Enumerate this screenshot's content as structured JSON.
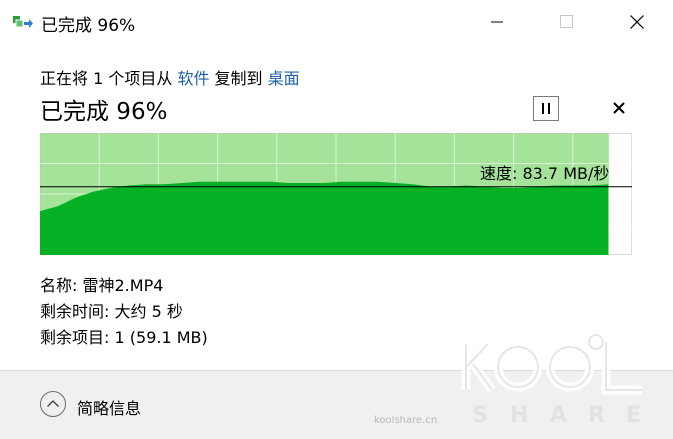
{
  "window": {
    "title": "已完成 96%",
    "icons": {
      "app": "copy-files-icon",
      "minimize": "minimize-icon",
      "maximize": "maximize-icon",
      "close": "close-icon"
    }
  },
  "copy_info": {
    "prefix": "正在将 1 个项目从 ",
    "source": "软件",
    "middle": " 复制到 ",
    "destination": "桌面"
  },
  "status": {
    "text": "已完成 96%",
    "percent": 96
  },
  "controls": {
    "pause_icon": "pause-icon",
    "stop_icon": "stop-icon"
  },
  "graph": {
    "speed_label": "速度: 83.7 MB/秒",
    "progress": 0.96,
    "fill_color": "#06b025",
    "background_color": "#a6e39a",
    "speed_line_level": 0.56,
    "speed_profile": [
      0.36,
      0.4,
      0.47,
      0.52,
      0.55,
      0.57,
      0.58,
      0.58,
      0.59,
      0.6,
      0.6,
      0.6,
      0.6,
      0.6,
      0.59,
      0.59,
      0.59,
      0.6,
      0.6,
      0.6,
      0.59,
      0.58,
      0.56,
      0.56,
      0.57,
      0.56,
      0.55,
      0.55,
      0.56,
      0.57,
      0.57,
      0.57,
      0.58
    ]
  },
  "details": {
    "name_label": "名称:",
    "name_value": "雷神2.MP4",
    "time_label": "剩余时间:",
    "time_value": "大约 5 秒",
    "items_label": "剩余项目:",
    "items_value": "1 (59.1 MB)"
  },
  "footer": {
    "toggle_icon": "chevron-up-icon",
    "label": "简略信息"
  },
  "watermark": {
    "text": "KOOL SHARE",
    "domain": "koolshare.cn"
  }
}
